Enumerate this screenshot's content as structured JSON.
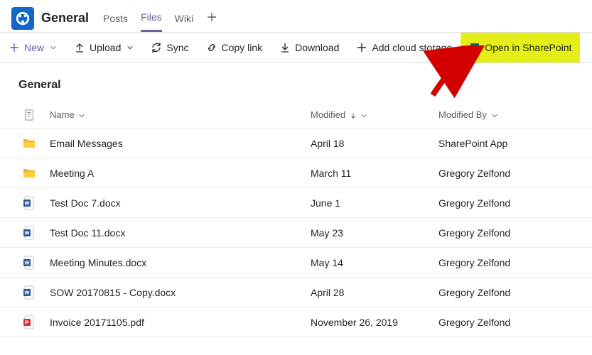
{
  "header": {
    "channel": "General",
    "tabs": [
      "Posts",
      "Files",
      "Wiki"
    ],
    "active_tab": 1
  },
  "toolbar": {
    "new": "New",
    "upload": "Upload",
    "sync": "Sync",
    "copy_link": "Copy link",
    "download": "Download",
    "add_cloud": "Add cloud storage",
    "open_sp": "Open in SharePoint"
  },
  "breadcrumb": "General",
  "columns": {
    "name": "Name",
    "modified": "Modified",
    "modified_by": "Modified By"
  },
  "files": [
    {
      "icon": "folder",
      "name": "Email Messages",
      "modified": "April 18",
      "by": "SharePoint App"
    },
    {
      "icon": "folder",
      "name": "Meeting A",
      "modified": "March 11",
      "by": "Gregory Zelfond"
    },
    {
      "icon": "word",
      "name": "Test Doc 7.docx",
      "modified": "June 1",
      "by": "Gregory Zelfond"
    },
    {
      "icon": "word",
      "name": "Test Doc 11.docx",
      "modified": "May 23",
      "by": "Gregory Zelfond"
    },
    {
      "icon": "word",
      "name": "Meeting Minutes.docx",
      "modified": "May 14",
      "by": "Gregory Zelfond"
    },
    {
      "icon": "word",
      "name": "SOW 20170815 - Copy.docx",
      "modified": "April 28",
      "by": "Gregory Zelfond"
    },
    {
      "icon": "pdf",
      "name": "Invoice 20171105.pdf",
      "modified": "November 26, 2019",
      "by": "Gregory Zelfond"
    }
  ]
}
